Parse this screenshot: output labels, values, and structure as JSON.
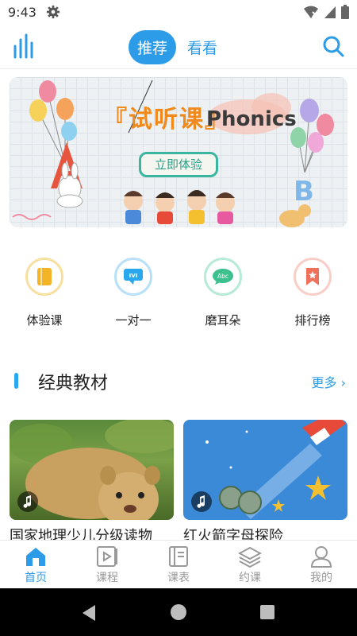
{
  "status_bar": {
    "time": "9:43"
  },
  "top_nav": {
    "tabs": [
      {
        "label": "推荐",
        "active": true
      },
      {
        "label": "看看",
        "active": false
      }
    ]
  },
  "banner": {
    "title": "『试听课』",
    "subtitle": "Phonics",
    "button_label": "立即体验"
  },
  "quick_entries": [
    {
      "label": "体验课",
      "icon": "book-icon",
      "color": "#f5b428"
    },
    {
      "label": "一对一",
      "icon": "chat-icon",
      "color": "#29a8f0"
    },
    {
      "label": "磨耳朵",
      "icon": "abc-bubble-icon",
      "color": "#3cc08e"
    },
    {
      "label": "排行榜",
      "icon": "bookmark-star-icon",
      "color": "#f0705c"
    }
  ],
  "section": {
    "title": "经典教材",
    "more_label": "更多"
  },
  "cards": [
    {
      "title": "国家地理少儿分级读物",
      "image": "lion-cub-photo"
    },
    {
      "title": "红火箭字母探险",
      "image": "rocket-illustration"
    }
  ],
  "bottom_nav": [
    {
      "label": "首页",
      "icon": "home-icon",
      "active": true
    },
    {
      "label": "课程",
      "icon": "play-course-icon",
      "active": false
    },
    {
      "label": "课表",
      "icon": "notebook-icon",
      "active": false
    },
    {
      "label": "约课",
      "icon": "layers-icon",
      "active": false
    },
    {
      "label": "我的",
      "icon": "user-icon",
      "active": false
    }
  ],
  "colors": {
    "accent": "#2c9be8",
    "inactive": "#999999"
  }
}
